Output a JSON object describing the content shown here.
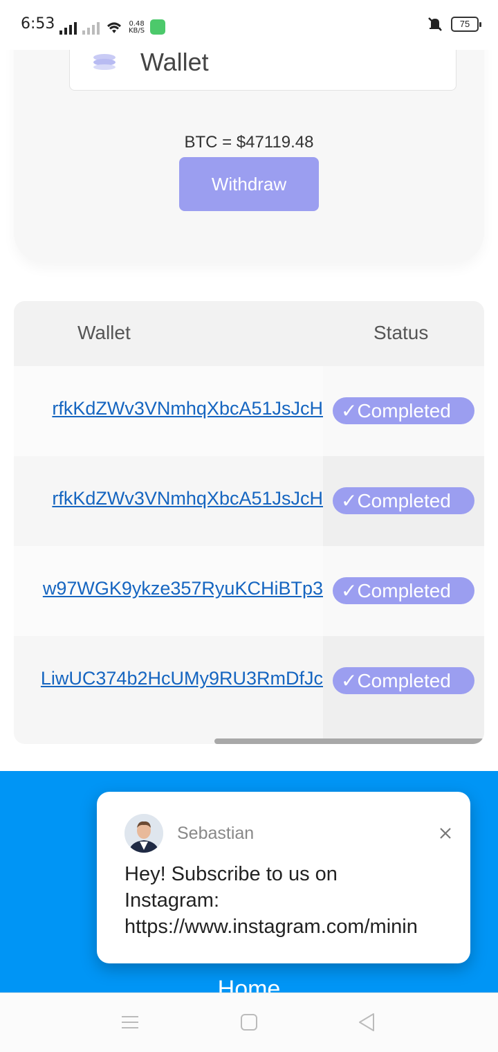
{
  "status_bar": {
    "time": "6:53",
    "net_speed_value": "0.48",
    "net_speed_unit": "KB/S",
    "battery": "75"
  },
  "wallet_card": {
    "title": "Wallet",
    "btc_price": "BTC = $47119.48",
    "withdraw_label": "Withdraw"
  },
  "table": {
    "headers": [
      "Wallet",
      "Status"
    ],
    "rows": [
      {
        "address": "rfkKdZWv3VNmhqXbcA51JsJcH",
        "status": "✓Completed"
      },
      {
        "address": "rfkKdZWv3VNmhqXbcA51JsJcH",
        "status": "✓Completed"
      },
      {
        "address": "w97WGK9ykze357RyuKCHiBTp3",
        "status": "✓Completed"
      },
      {
        "address": "LiwUC374b2HcUMy9RU3RmDfJc",
        "status": "✓Completed"
      }
    ]
  },
  "popup": {
    "name": "Sebastian",
    "message": "Hey! Subscribe to us on\nInstagram:\nhttps://www.instagram.com/minin"
  },
  "footer": {
    "home_label": "Home",
    "background": "#0095f5"
  },
  "colors": {
    "accent": "#9b9ef0",
    "link": "#1565c0"
  },
  "icons": {
    "signal": "signal-icon",
    "wifi": "wifi-icon",
    "mute": "bell-muted-icon",
    "close": "close-icon",
    "menu": "menu-icon",
    "home": "home-square-icon",
    "back": "back-triangle-icon"
  }
}
